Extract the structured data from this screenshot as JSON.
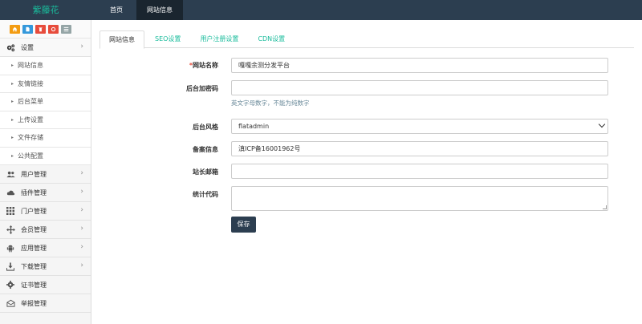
{
  "header": {
    "brand": "紫藤花",
    "nav": [
      {
        "label": "首页"
      },
      {
        "label": "网站信息"
      }
    ]
  },
  "sidebar": {
    "shortcuts": [
      {
        "icon": "home-icon",
        "color": "#f39c12"
      },
      {
        "icon": "file-icon",
        "color": "#3498db"
      },
      {
        "icon": "trash-icon",
        "color": "#e74c3c"
      },
      {
        "icon": "refresh-icon",
        "color": "#e74c3c"
      },
      {
        "icon": "list-icon",
        "color": "#95a5a6"
      }
    ],
    "settings_group": {
      "label": "设置"
    },
    "settings_items": [
      {
        "label": "网站信息"
      },
      {
        "label": "友情链接"
      },
      {
        "label": "后台菜单"
      },
      {
        "label": "上传设置"
      },
      {
        "label": "文件存储"
      },
      {
        "label": "公共配置"
      }
    ],
    "groups": [
      {
        "label": "用户管理",
        "icon": "users-icon"
      },
      {
        "label": "插件管理",
        "icon": "cloud-icon"
      },
      {
        "label": "门户管理",
        "icon": "grid-icon"
      },
      {
        "label": "会员管理",
        "icon": "move-icon"
      },
      {
        "label": "应用管理",
        "icon": "android-icon"
      },
      {
        "label": "下载管理",
        "icon": "download-icon"
      },
      {
        "label": "证书管理",
        "icon": "gear-icon"
      },
      {
        "label": "举报管理",
        "icon": "envelope-icon"
      }
    ]
  },
  "tabs": [
    {
      "label": "网站信息"
    },
    {
      "label": "SEO设置"
    },
    {
      "label": "用户注册设置"
    },
    {
      "label": "CDN设置"
    }
  ],
  "form": {
    "site_name": {
      "required_mark": "*",
      "label": "网站名称",
      "value": "嘎嘎余测分发平台"
    },
    "admin_code": {
      "label": "后台加密码",
      "value": "",
      "help": "英文字母数字，不能为纯数字"
    },
    "admin_style": {
      "label": "后台风格",
      "value": "flatadmin"
    },
    "icp": {
      "label": "备案信息",
      "value": "滇ICP备16001962号"
    },
    "email": {
      "label": "站长邮箱",
      "value": ""
    },
    "stats_code": {
      "label": "统计代码",
      "value": ""
    },
    "save_label": "保存"
  }
}
